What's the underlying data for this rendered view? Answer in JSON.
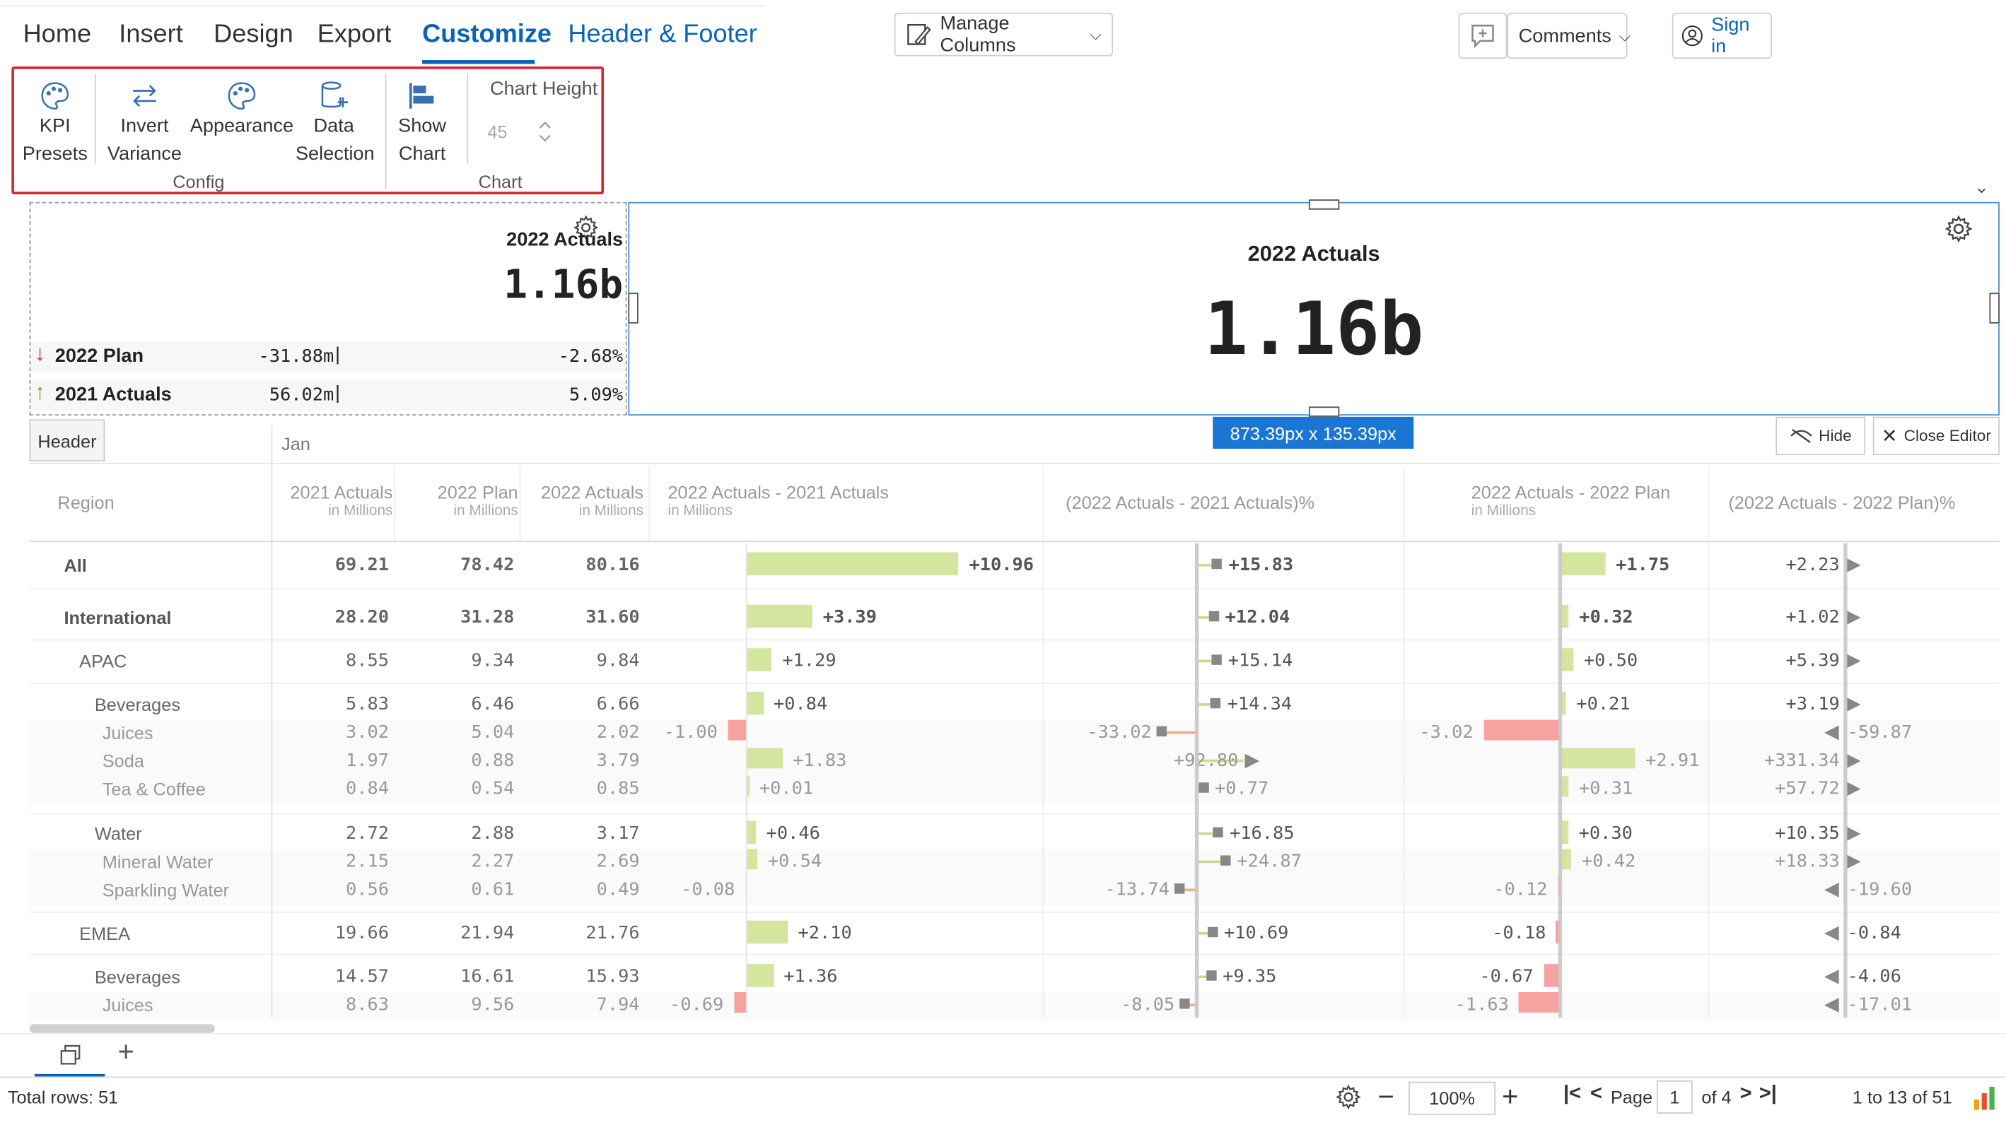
{
  "menu": {
    "items": [
      "Home",
      "Insert",
      "Design",
      "Export",
      "Customize",
      "Header & Footer"
    ]
  },
  "toolbar": {
    "manage_columns": "Manage Columns",
    "comments": "Comments",
    "sign_in": "Sign in"
  },
  "ribbon": {
    "kpi_presets": [
      "KPI",
      "Presets"
    ],
    "invert_variance": [
      "Invert",
      "Variance"
    ],
    "appearance": "Appearance",
    "data_selection": [
      "Data",
      "Selection"
    ],
    "show_chart": [
      "Show",
      "Chart"
    ],
    "chart_height_label": "Chart Height",
    "chart_height_value": "45",
    "group_config": "Config",
    "group_chart": "Chart"
  },
  "kpi_small": {
    "title": "2022 Actuals",
    "value": "1.16b",
    "rows": [
      {
        "label": "2022 Plan",
        "abs": "-31.88m",
        "pct": "-2.68%",
        "dir": "down"
      },
      {
        "label": "2021 Actuals",
        "abs": "56.02m",
        "pct": "5.09%",
        "dir": "up"
      }
    ]
  },
  "kpi_big": {
    "title": "2022 Actuals",
    "value": "1.16b"
  },
  "dimensions": "873.39px x 135.39px",
  "grid": {
    "header_tab": "Header",
    "hide": "Hide",
    "close_editor": "Close Editor",
    "period": "Jan",
    "columns": {
      "region": "Region",
      "a21": "2021 Actuals",
      "p22": "2022 Plan",
      "a22": "2022 Actuals",
      "unit": "in Millions",
      "d1": "2022 Actuals - 2021 Actuals",
      "d1pct": "(2022 Actuals - 2021 Actuals)%",
      "d2": "2022 Actuals - 2022 Plan",
      "d2pct": "(2022 Actuals - 2022 Plan)%"
    },
    "rows": [
      {
        "region": "All",
        "level": 0,
        "bold": true,
        "a21": "69.21",
        "p22": "78.42",
        "a22": "80.16",
        "d1": "+10.96",
        "d1pct": "+15.83",
        "d2": "+1.75",
        "d2pct": "+2.23"
      },
      {
        "region": "International",
        "level": 0,
        "bold": true,
        "a21": "28.20",
        "p22": "31.28",
        "a22": "31.60",
        "d1": "+3.39",
        "d1pct": "+12.04",
        "d2": "+0.32",
        "d2pct": "+1.02"
      },
      {
        "region": "APAC",
        "level": 1,
        "bold": false,
        "a21": "8.55",
        "p22": "9.34",
        "a22": "9.84",
        "d1": "+1.29",
        "d1pct": "+15.14",
        "d2": "+0.50",
        "d2pct": "+5.39"
      },
      {
        "region": "Beverages",
        "level": 2,
        "bold": false,
        "a21": "5.83",
        "p22": "6.46",
        "a22": "6.66",
        "d1": "+0.84",
        "d1pct": "+14.34",
        "d2": "+0.21",
        "d2pct": "+3.19"
      },
      {
        "region": "Juices",
        "level": 3,
        "bold": false,
        "a21": "3.02",
        "p22": "5.04",
        "a22": "2.02",
        "d1": "-1.00",
        "d1pct": "-33.02",
        "d2": "-3.02",
        "d2pct": "-59.87"
      },
      {
        "region": "Soda",
        "level": 3,
        "bold": false,
        "a21": "1.97",
        "p22": "0.88",
        "a22": "3.79",
        "d1": "+1.83",
        "d1pct": "+92.80",
        "d2": "+2.91",
        "d2pct": "+331.34"
      },
      {
        "region": "Tea & Coffee",
        "level": 3,
        "bold": false,
        "a21": "0.84",
        "p22": "0.54",
        "a22": "0.85",
        "d1": "+0.01",
        "d1pct": "+0.77",
        "d2": "+0.31",
        "d2pct": "+57.72"
      },
      {
        "region": "Water",
        "level": 2,
        "bold": false,
        "a21": "2.72",
        "p22": "2.88",
        "a22": "3.17",
        "d1": "+0.46",
        "d1pct": "+16.85",
        "d2": "+0.30",
        "d2pct": "+10.35"
      },
      {
        "region": "Mineral Water",
        "level": 3,
        "bold": false,
        "a21": "2.15",
        "p22": "2.27",
        "a22": "2.69",
        "d1": "+0.54",
        "d1pct": "+24.87",
        "d2": "+0.42",
        "d2pct": "+18.33"
      },
      {
        "region": "Sparkling Water",
        "level": 3,
        "bold": false,
        "a21": "0.56",
        "p22": "0.61",
        "a22": "0.49",
        "d1": "-0.08",
        "d1pct": "-13.74",
        "d2": "-0.12",
        "d2pct": "-19.60"
      },
      {
        "region": "EMEA",
        "level": 1,
        "bold": false,
        "a21": "19.66",
        "p22": "21.94",
        "a22": "21.76",
        "d1": "+2.10",
        "d1pct": "+10.69",
        "d2": "-0.18",
        "d2pct": "-0.84"
      },
      {
        "region": "Beverages",
        "level": 2,
        "bold": false,
        "a21": "14.57",
        "p22": "16.61",
        "a22": "15.93",
        "d1": "+1.36",
        "d1pct": "+9.35",
        "d2": "-0.67",
        "d2pct": "-4.06"
      },
      {
        "region": "Juices",
        "level": 3,
        "bold": false,
        "a21": "8.63",
        "p22": "9.56",
        "a22": "7.94",
        "d1": "-0.69",
        "d1pct": "-8.05",
        "d2": "-1.63",
        "d2pct": "-17.01"
      }
    ]
  },
  "footer": {
    "total_rows": "Total rows: 51",
    "zoom": "100%",
    "page_label": "Page",
    "page_value": "1",
    "page_of": "of 4",
    "range": "1 to 13 of 51"
  },
  "colors": {
    "accent": "#0b63b8",
    "positive": "#d4e5a0",
    "negative": "#f7a1a1",
    "highlight": "#d9262e"
  }
}
